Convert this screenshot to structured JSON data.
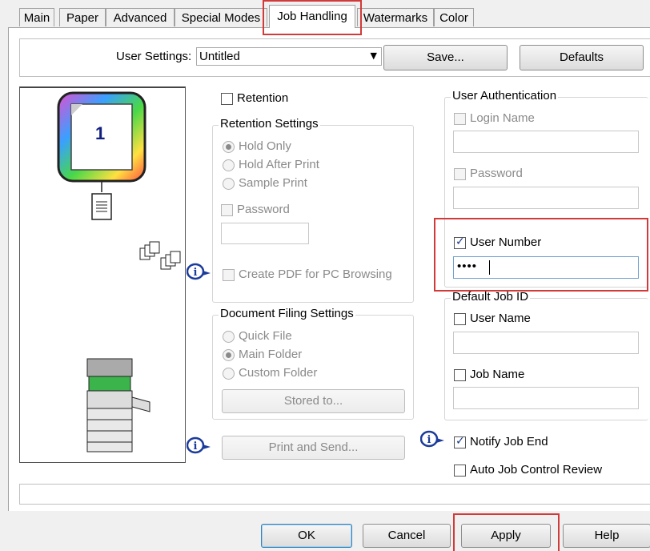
{
  "tabs": [
    "Main",
    "Paper",
    "Advanced",
    "Special Modes",
    "Job Handling",
    "Watermarks",
    "Color"
  ],
  "active_tab": "Job Handling",
  "user_settings": {
    "label": "User Settings:",
    "value": "Untitled",
    "save_label": "Save...",
    "defaults_label": "Defaults"
  },
  "preview": {
    "page_number": "1"
  },
  "retention": {
    "checkbox_label": "Retention",
    "settings_title": "Retention Settings",
    "options": [
      "Hold Only",
      "Hold After Print",
      "Sample Print"
    ],
    "selected": "Hold Only",
    "password_label": "Password",
    "create_pdf_label": "Create PDF for PC Browsing"
  },
  "document_filing": {
    "title": "Document Filing Settings",
    "options": [
      "Quick File",
      "Main Folder",
      "Custom Folder"
    ],
    "selected": "Main Folder",
    "stored_to_label": "Stored to..."
  },
  "print_and_send_label": "Print and Send...",
  "user_authentication": {
    "title": "User Authentication",
    "login_name_label": "Login Name",
    "password_label": "Password",
    "user_number_label": "User Number",
    "user_number_checked": true,
    "user_number_value": "••••"
  },
  "default_job_id": {
    "title": "Default Job ID",
    "user_name_label": "User Name",
    "job_name_label": "Job Name"
  },
  "notify_job_end_label": "Notify Job End",
  "notify_job_end_checked": true,
  "auto_job_control_label": "Auto Job Control Review",
  "buttons": {
    "ok": "OK",
    "cancel": "Cancel",
    "apply": "Apply",
    "help": "Help"
  },
  "highlight_color": "#d23a3a"
}
